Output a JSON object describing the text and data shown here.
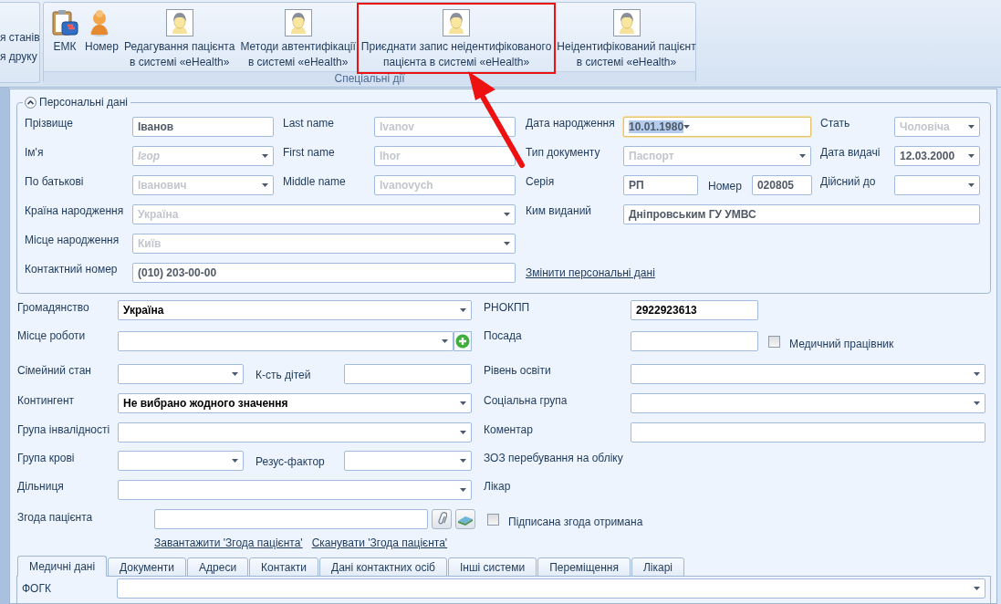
{
  "ribbon": {
    "left_group": {
      "items": [
        "я станів",
        "я друку"
      ]
    },
    "group": {
      "label": "Спеціальні дії",
      "buttons": [
        {
          "kind": "clipboard",
          "lines": [
            "ЕМК"
          ],
          "highlighted": false
        },
        {
          "kind": "person",
          "lines": [
            "Номер"
          ],
          "highlighted": false
        },
        {
          "kind": "avatar",
          "lines": [
            "Редагування пацієнта",
            "в системі «eHealth»"
          ],
          "highlighted": false
        },
        {
          "kind": "avatar",
          "lines": [
            "Методи автентифікації",
            "в системі «eHealth»"
          ],
          "highlighted": false
        },
        {
          "kind": "avatar",
          "lines": [
            "Приєднати запис неідентифікованого",
            "пацієнта в системі «eHealth»"
          ],
          "highlighted": true
        },
        {
          "kind": "avatar",
          "lines": [
            "Неідентифікований пацієнт",
            "в системі «eHealth»"
          ],
          "highlighted": false
        }
      ]
    }
  },
  "personal_data": {
    "title": "Персональні дані",
    "expanded": true,
    "surname": {
      "label": "Прізвище",
      "kind": "text",
      "value": "Іванов",
      "disabled": false
    },
    "last_name": {
      "label": "Last name",
      "kind": "text",
      "value": "Ivanov",
      "disabled": true
    },
    "birth_date": {
      "label": "Дата народження",
      "kind": "combo",
      "value": "10.01.1980",
      "disabled": false,
      "focused": true
    },
    "sex": {
      "label": "Стать",
      "kind": "combo",
      "value": "Чоловіча",
      "disabled": true
    },
    "given_name": {
      "label": "Ім'я",
      "kind": "combo",
      "placeholder": "Ігор",
      "disabled": true
    },
    "first_name": {
      "label": "First name",
      "kind": "text",
      "value": "Ihor",
      "disabled": true
    },
    "document_type": {
      "label": "Тип документу",
      "kind": "combo",
      "value": "Паспорт",
      "disabled": true
    },
    "issue_date": {
      "label": "Дата видачі",
      "kind": "combo",
      "value": "12.03.2000",
      "disabled": false
    },
    "patronymic": {
      "label": "По батькові",
      "kind": "combo",
      "value": "Іванович",
      "disabled": true
    },
    "middle_name": {
      "label": "Middle name",
      "kind": "text",
      "value": "Ivanovych",
      "disabled": true
    },
    "series": {
      "label": "Серія",
      "kind": "text",
      "value": "РП",
      "disabled": false
    },
    "number": {
      "label": "Номер",
      "kind": "text",
      "value": "020805",
      "disabled": false
    },
    "valid_until": {
      "label": "Дійсний до",
      "kind": "combo",
      "disabled": false
    },
    "birth_country": {
      "label": "Країна народження",
      "kind": "combo",
      "value": "Україна",
      "disabled": true
    },
    "issued_by": {
      "label": "Ким виданий",
      "kind": "text",
      "value": "Дніпровським ГУ УМВС",
      "disabled": false
    },
    "birth_place": {
      "label": "Місце народження",
      "kind": "combo",
      "value": "Київ",
      "disabled": true
    },
    "contact_number": {
      "label": "Контактний номер",
      "kind": "text",
      "value": "(010) 203-00-00",
      "disabled": false
    },
    "change_link": "Змінити персональні дані"
  },
  "details": {
    "citizenship": {
      "label": "Громадянство",
      "kind": "combo",
      "value": "Україна"
    },
    "tax_number": {
      "label": "РНОКПП",
      "kind": "text",
      "value": "2922923613"
    },
    "workplace": {
      "label": "Місце роботи",
      "kind": "combo"
    },
    "position": {
      "label": "Посада",
      "kind": "text"
    },
    "medical_worker": {
      "label": "Медичний працівник",
      "checked": false
    },
    "marital_status": {
      "label": "Сімейний стан",
      "kind": "combo"
    },
    "children_count": {
      "label": "К-сть дітей",
      "kind": "text"
    },
    "education": {
      "label": "Рівень освіти",
      "kind": "combo"
    },
    "contingent": {
      "label": "Контингент",
      "kind": "combo",
      "value": "Не вибрано жодного значення"
    },
    "social_group": {
      "label": "Соціальна група",
      "kind": "combo"
    },
    "disability_group": {
      "label": "Група інвалідності",
      "kind": "combo"
    },
    "comment": {
      "label": "Коментар",
      "kind": "text"
    },
    "blood_group": {
      "label": "Група крові",
      "kind": "combo"
    },
    "rh_factor": {
      "label": "Резус-фактор",
      "kind": "combo"
    },
    "facility_label": "ЗОЗ перебування на обліку",
    "district": {
      "label": "Дільниця",
      "kind": "combo"
    },
    "doctor_label": "Лікар",
    "consent": {
      "label": "Згода пацієнта",
      "kind": "text"
    },
    "consent_signed": {
      "label": "Підписана згода отримана",
      "checked": false
    },
    "consent_links": [
      "Завантажити 'Згода пацієнта'",
      "Сканувати 'Згода пацієнта'"
    ]
  },
  "tabs": [
    {
      "label": "Медичні дані",
      "selected": true
    },
    {
      "label": "Документи",
      "selected": false
    },
    {
      "label": "Адреси",
      "selected": false
    },
    {
      "label": "Контакти",
      "selected": false
    },
    {
      "label": "Дані контактних осіб",
      "selected": false
    },
    {
      "label": "Інші системи",
      "selected": false
    },
    {
      "label": "Переміщення",
      "selected": false
    },
    {
      "label": "Лікарі",
      "selected": false
    }
  ],
  "tab_content": {
    "fogk": {
      "label": "ФОГК",
      "kind": "combo"
    }
  }
}
